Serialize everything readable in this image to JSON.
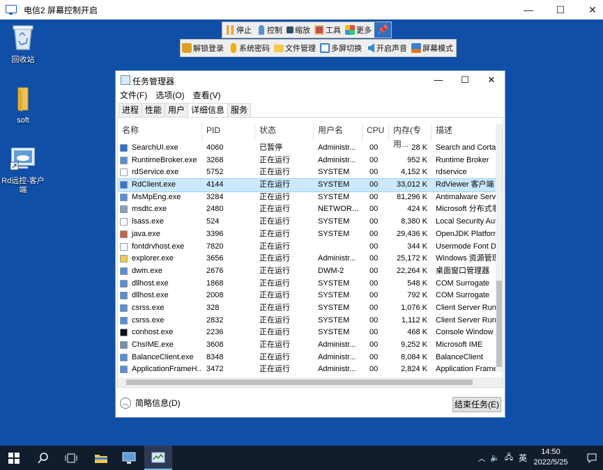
{
  "window": {
    "title": "电信2   屏幕控制开启",
    "minimize": "—",
    "maximize": "☐",
    "close": "✕"
  },
  "desktop_icons": [
    {
      "label": "回收站",
      "icon": "recycle-bin-icon"
    },
    {
      "label": "soft",
      "icon": "folder-icon"
    },
    {
      "label": "Rd远控-客户端",
      "icon": "shortcut-icon"
    }
  ],
  "toolbar_top": [
    {
      "label": "停止",
      "icon": "pause-icon",
      "color": "#e8a43a"
    },
    {
      "label": "控制",
      "icon": "hand-icon",
      "color": "#5a8fd0"
    },
    {
      "label": "缩放",
      "icon": "zoom-icon",
      "color": "#4b8b3b"
    },
    {
      "label": "工具",
      "icon": "toolbox-icon",
      "color": "#c0504d"
    },
    {
      "label": "更多",
      "icon": "more-icon",
      "color": "#7fb13f"
    },
    {
      "label": "",
      "icon": "pin-icon",
      "color": "#2e6fc2"
    }
  ],
  "toolbar_second": [
    {
      "label": "解锁登录",
      "icon": "lock-icon",
      "color": "#e0a020"
    },
    {
      "label": "系统密码",
      "icon": "key-icon",
      "color": "#f0b000"
    },
    {
      "label": "文件管理",
      "icon": "folder-icon",
      "color": "#f3c94a"
    },
    {
      "label": "多屏切换",
      "icon": "monitor-icon",
      "color": "#3a7fd0"
    },
    {
      "label": "开启声音",
      "icon": "speaker-icon",
      "color": "#2f8ad8"
    },
    {
      "label": "屏幕模式",
      "icon": "screen-icon",
      "color": "#e07a1f"
    }
  ],
  "task_manager": {
    "title": "任务管理器",
    "menu": [
      "文件(F)",
      "选项(O)",
      "查看(V)"
    ],
    "tabs": [
      "进程",
      "性能",
      "用户",
      "详细信息",
      "服务"
    ],
    "active_tab": "详细信息",
    "columns": [
      "名称",
      "PID",
      "状态",
      "用户名",
      "CPU",
      "内存(专用...",
      "描述"
    ],
    "rows": [
      {
        "name": "SearchUI.exe",
        "pid": "4060",
        "status": "已暂停",
        "user": "Administr...",
        "cpu": "00",
        "mem": "28 K",
        "desc": "Search and Cortana",
        "color": "#2f6fcf"
      },
      {
        "name": "RuntimeBroker.exe",
        "pid": "3268",
        "status": "正在运行",
        "user": "Administr...",
        "cpu": "00",
        "mem": "952 K",
        "desc": "Runtime Broker",
        "color": "#5b8ed6"
      },
      {
        "name": "rdService.exe",
        "pid": "5752",
        "status": "正在运行",
        "user": "SYSTEM",
        "cpu": "00",
        "mem": "4,152 K",
        "desc": "rdservice",
        "color": "#ffffff"
      },
      {
        "name": "RdClient.exe",
        "pid": "4144",
        "status": "正在运行",
        "user": "SYSTEM",
        "cpu": "00",
        "mem": "33,012 K",
        "desc": "RdViewer 客户端",
        "color": "#3a73c8"
      },
      {
        "name": "MsMpEng.exe",
        "pid": "3284",
        "status": "正在运行",
        "user": "SYSTEM",
        "cpu": "00",
        "mem": "81,296 K",
        "desc": "Antimalware Service",
        "color": "#5b8ed6"
      },
      {
        "name": "msdtc.exe",
        "pid": "2480",
        "status": "正在运行",
        "user": "NETWOR...",
        "cpu": "00",
        "mem": "424 K",
        "desc": "Microsoft 分布式事务",
        "color": "#8aa0b8"
      },
      {
        "name": "lsass.exe",
        "pid": "524",
        "status": "正在运行",
        "user": "SYSTEM",
        "cpu": "00",
        "mem": "8,380 K",
        "desc": "Local Security Autho",
        "color": "#ffffff"
      },
      {
        "name": "java.exe",
        "pid": "3396",
        "status": "正在运行",
        "user": "SYSTEM",
        "cpu": "00",
        "mem": "29,436 K",
        "desc": "OpenJDK Platform",
        "color": "#d2623c"
      },
      {
        "name": "fontdrvhost.exe",
        "pid": "7820",
        "status": "正在运行",
        "user": "",
        "cpu": "00",
        "mem": "344 K",
        "desc": "Usermode Font Driv",
        "color": "#ffffff"
      },
      {
        "name": "explorer.exe",
        "pid": "3656",
        "status": "正在运行",
        "user": "Administr...",
        "cpu": "00",
        "mem": "25,172 K",
        "desc": "Windows 资源管理",
        "color": "#f3c94a"
      },
      {
        "name": "dwm.exe",
        "pid": "2676",
        "status": "正在运行",
        "user": "DWM-2",
        "cpu": "00",
        "mem": "22,264 K",
        "desc": "桌面窗口管理器",
        "color": "#5b8ed6"
      },
      {
        "name": "dllhost.exe",
        "pid": "1868",
        "status": "正在运行",
        "user": "SYSTEM",
        "cpu": "00",
        "mem": "548 K",
        "desc": "COM Surrogate",
        "color": "#5b8ed6"
      },
      {
        "name": "dllhost.exe",
        "pid": "2008",
        "status": "正在运行",
        "user": "SYSTEM",
        "cpu": "00",
        "mem": "792 K",
        "desc": "COM Surrogate",
        "color": "#5b8ed6"
      },
      {
        "name": "csrss.exe",
        "pid": "328",
        "status": "正在运行",
        "user": "SYSTEM",
        "cpu": "00",
        "mem": "1,076 K",
        "desc": "Client Server Runti",
        "color": "#5b8ed6"
      },
      {
        "name": "csrss.exe",
        "pid": "2832",
        "status": "正在运行",
        "user": "SYSTEM",
        "cpu": "00",
        "mem": "1,112 K",
        "desc": "Client Server Runti",
        "color": "#5b8ed6"
      },
      {
        "name": "conhost.exe",
        "pid": "2236",
        "status": "正在运行",
        "user": "SYSTEM",
        "cpu": "00",
        "mem": "468 K",
        "desc": "Console Window Ho",
        "color": "#111111"
      },
      {
        "name": "ChsIME.exe",
        "pid": "3608",
        "status": "正在运行",
        "user": "Administr...",
        "cpu": "00",
        "mem": "9,252 K",
        "desc": "Microsoft IME",
        "color": "#7a8fa8"
      },
      {
        "name": "BalanceClient.exe",
        "pid": "8348",
        "status": "正在运行",
        "user": "Administr...",
        "cpu": "00",
        "mem": "8,084 K",
        "desc": "BalanceClient",
        "color": "#5b8ed6"
      },
      {
        "name": "ApplicationFrameH...",
        "pid": "3472",
        "status": "正在运行",
        "user": "Administr...",
        "cpu": "00",
        "mem": "2,824 K",
        "desc": "Application Frame",
        "color": "#5b8ed6"
      }
    ],
    "selected_row": "RdClient.exe",
    "footer_brief": "简略信息(D)",
    "end_task": "结束任务(E)"
  },
  "taskbar": {
    "ime": "英",
    "time": "14:50",
    "date": "2022/5/25"
  }
}
